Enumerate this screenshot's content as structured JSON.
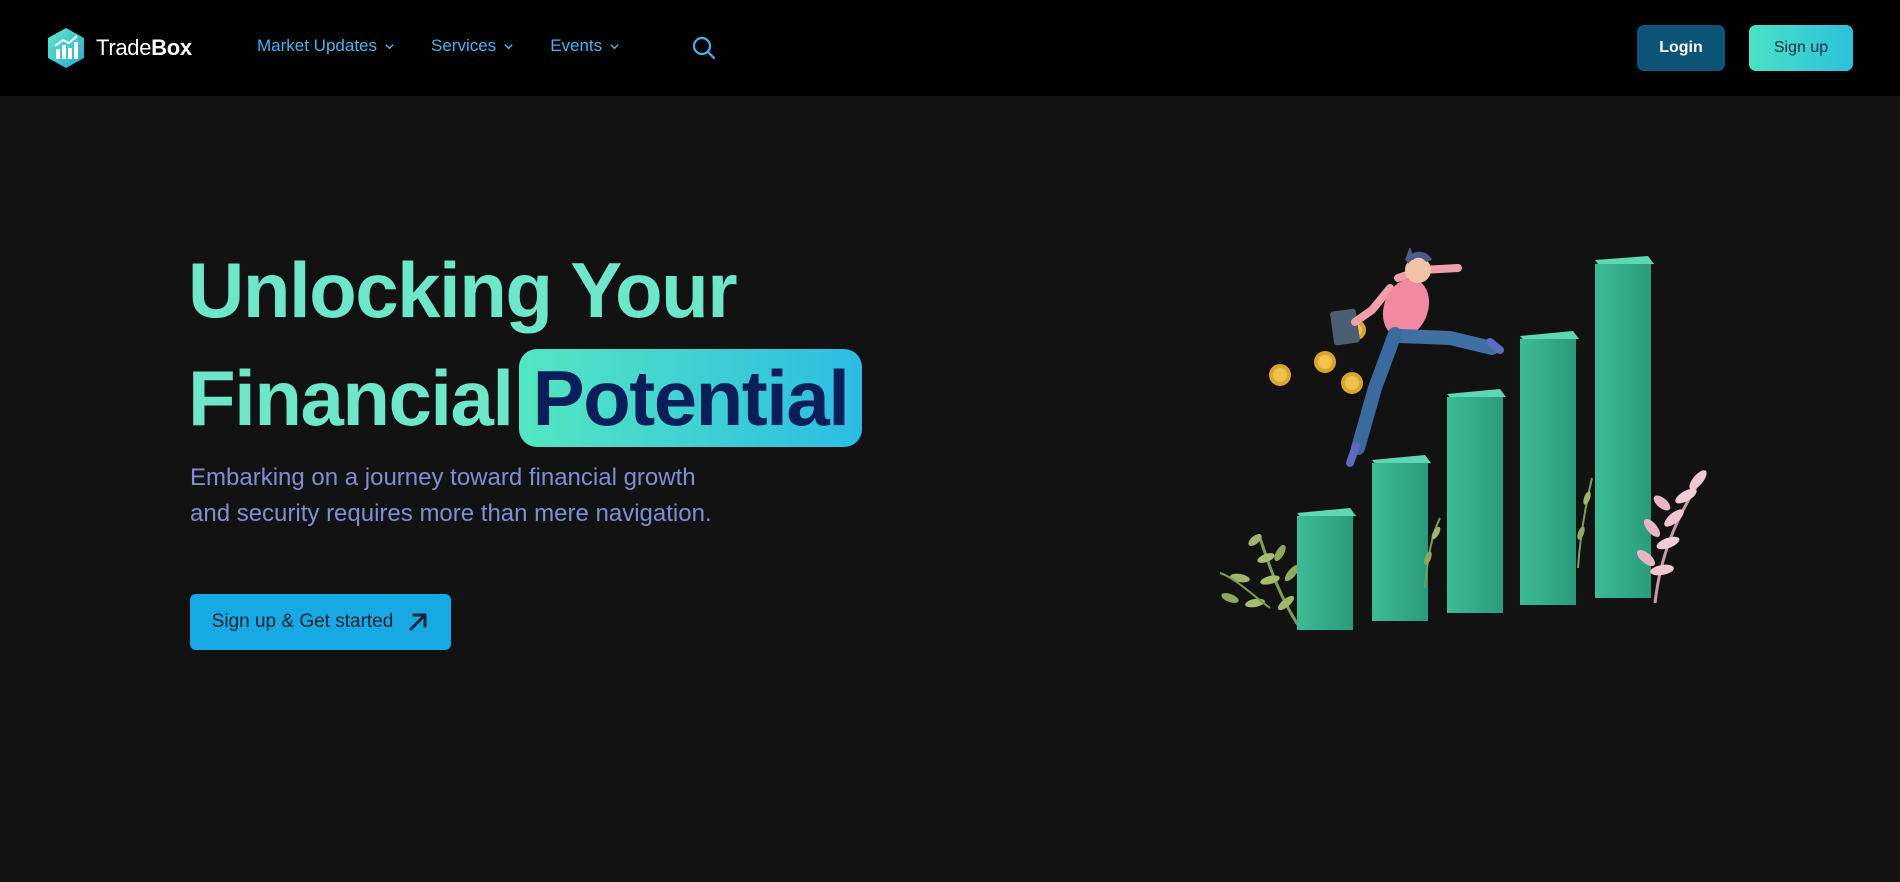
{
  "brand": {
    "name_part1": "Trade",
    "name_part2": "Box",
    "logo_icon": "bar-chart-hexagon-icon"
  },
  "nav": {
    "items": [
      {
        "label": "Market Updates",
        "icon": "chevron-down-icon"
      },
      {
        "label": "Services",
        "icon": "chevron-down-icon"
      },
      {
        "label": "Events",
        "icon": "chevron-down-icon"
      }
    ],
    "search_icon": "search-icon"
  },
  "auth": {
    "login_label": "Login",
    "signup_label": "Sign up"
  },
  "hero": {
    "title_line1": "Unlocking Your",
    "title_line2": "Financial",
    "title_highlight": "Potential",
    "subtitle_line1": "Embarking on a journey toward financial growth",
    "subtitle_line2": "and security requires more than mere navigation.",
    "cta_label": "Sign up & Get started",
    "cta_icon": "arrow-up-right-icon"
  },
  "illustration": {
    "description_icon": "growth-chart-illustration"
  },
  "colors": {
    "background": "#121212",
    "navbar": "#000000",
    "accent_mint": "#6ee6c8",
    "accent_blue": "#46b3ee",
    "login_bg": "#0c5577",
    "cta_bg": "#16a9e4",
    "subtitle": "#7d8fd6",
    "highlight_text": "#0a1f5a"
  }
}
